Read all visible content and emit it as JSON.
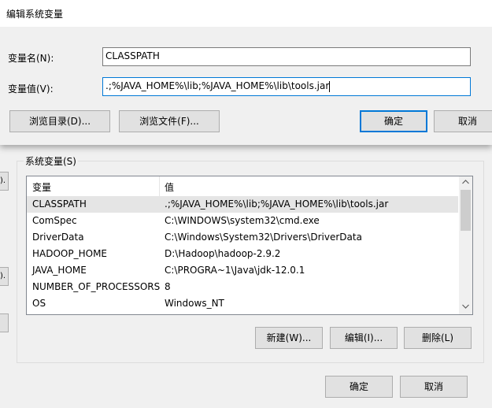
{
  "dialog": {
    "title": "编辑系统变量",
    "name_label": "变量名(N):",
    "name_value": "CLASSPATH",
    "value_label": "变量值(V):",
    "value_value": ".;%JAVA_HOME%\\lib;%JAVA_HOME%\\lib\\tools.jar",
    "browse_dir_label": "浏览目录(D)...",
    "browse_file_label": "浏览文件(F)...",
    "ok_label": "确定",
    "cancel_label": "取消"
  },
  "background": {
    "left_fragments": [
      ").",
      ").",
      ""
    ],
    "system_vars": {
      "group_label": "系统变量(S)",
      "columns": [
        "变量",
        "值"
      ],
      "rows": [
        {
          "name": "CLASSPATH",
          "value": ".;%JAVA_HOME%\\lib;%JAVA_HOME%\\lib\\tools.jar"
        },
        {
          "name": "ComSpec",
          "value": "C:\\WINDOWS\\system32\\cmd.exe"
        },
        {
          "name": "DriverData",
          "value": "C:\\Windows\\System32\\Drivers\\DriverData"
        },
        {
          "name": "HADOOP_HOME",
          "value": "D:\\Hadoop\\hadoop-2.9.2"
        },
        {
          "name": "JAVA_HOME",
          "value": "C:\\PROGRA~1\\Java\\jdk-12.0.1"
        },
        {
          "name": "NUMBER_OF_PROCESSORS",
          "value": "8"
        },
        {
          "name": "OS",
          "value": "Windows_NT"
        }
      ],
      "new_label": "新建(W)...",
      "edit_label": "编辑(I)...",
      "delete_label": "删除(L)"
    },
    "ok_label": "确定",
    "cancel_label": "取消"
  },
  "colors": {
    "accent": "#0078d7",
    "selection": "#e5e5e5",
    "button_face": "#e1e1e1"
  }
}
